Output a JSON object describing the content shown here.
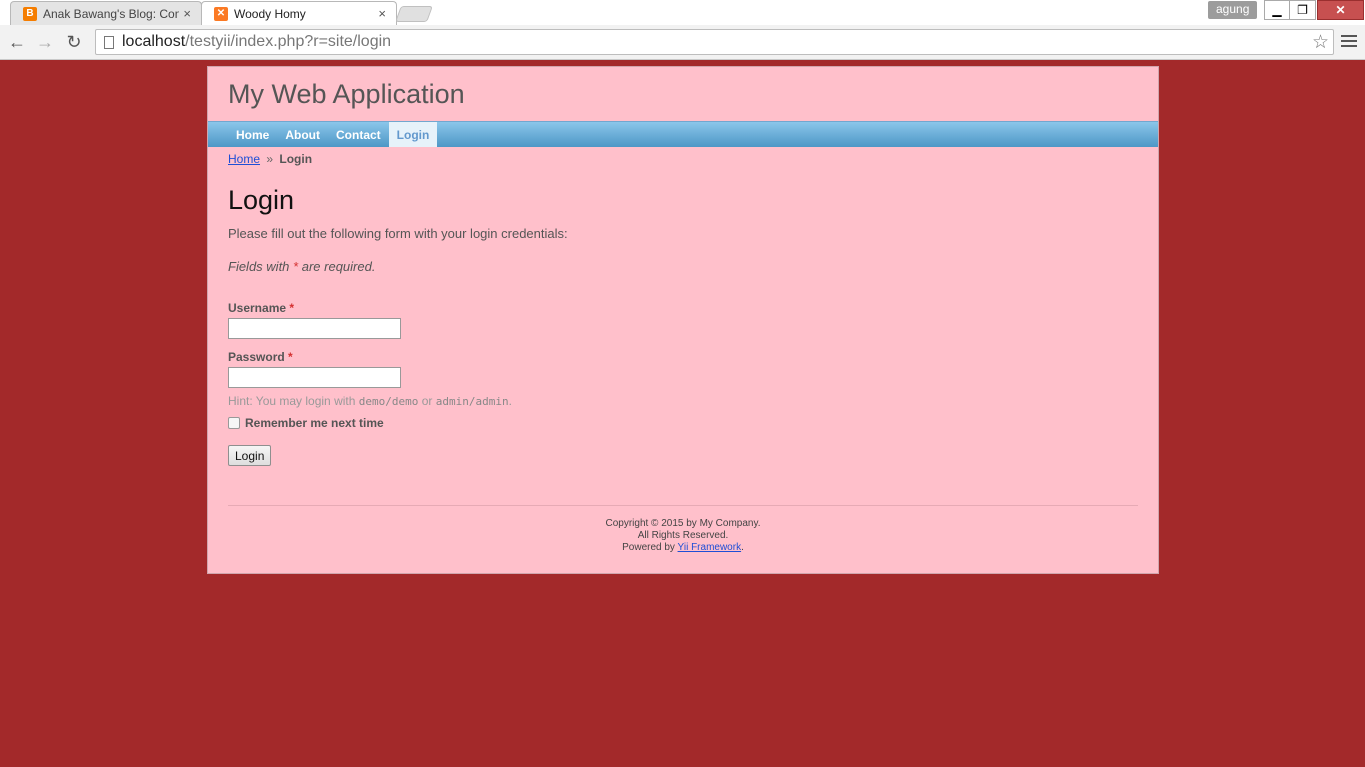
{
  "browser": {
    "tabs": [
      {
        "title": "Anak Bawang's Blog: Cont",
        "icon": "blogger-icon",
        "active": false
      },
      {
        "title": "Woody Homy",
        "icon": "xampp-icon",
        "active": true
      }
    ],
    "profile_name": "agung",
    "url_host": "localhost",
    "url_path": "/testyii/index.php?r=site/login",
    "close_glyph": "×"
  },
  "site": {
    "name": "My Web Application",
    "menu": [
      {
        "label": "Home",
        "active": false
      },
      {
        "label": "About",
        "active": false
      },
      {
        "label": "Contact",
        "active": false
      },
      {
        "label": "Login",
        "active": true
      }
    ],
    "breadcrumb": {
      "home": "Home",
      "separator": "»",
      "current": "Login"
    }
  },
  "login": {
    "title": "Login",
    "intro": "Please fill out the following form with your login credentials:",
    "required_prefix": "Fields with",
    "required_star": "*",
    "required_suffix": "are required.",
    "username_label": "Username",
    "password_label": "Password",
    "username_value": "",
    "password_value": "",
    "hint_prefix": "Hint: You may login with",
    "hint_demo": "demo/demo",
    "hint_or": "or",
    "hint_admin": "admin/admin",
    "hint_end": ".",
    "remember_label": "Remember me next time",
    "remember_checked": false,
    "submit_label": "Login"
  },
  "footer": {
    "copyright": "Copyright © 2015 by My Company.",
    "rights": "All Rights Reserved.",
    "powered_prefix": "Powered by",
    "powered_link": "Yii Framework",
    "powered_suffix": "."
  },
  "colors": {
    "page_background": "#a3292a",
    "content_background": "#ffc0cb",
    "menu_gradient_top": "#8bc6ea",
    "menu_gradient_bottom": "#4d97c6",
    "link": "#1f4fd6",
    "required": "#d43030"
  }
}
